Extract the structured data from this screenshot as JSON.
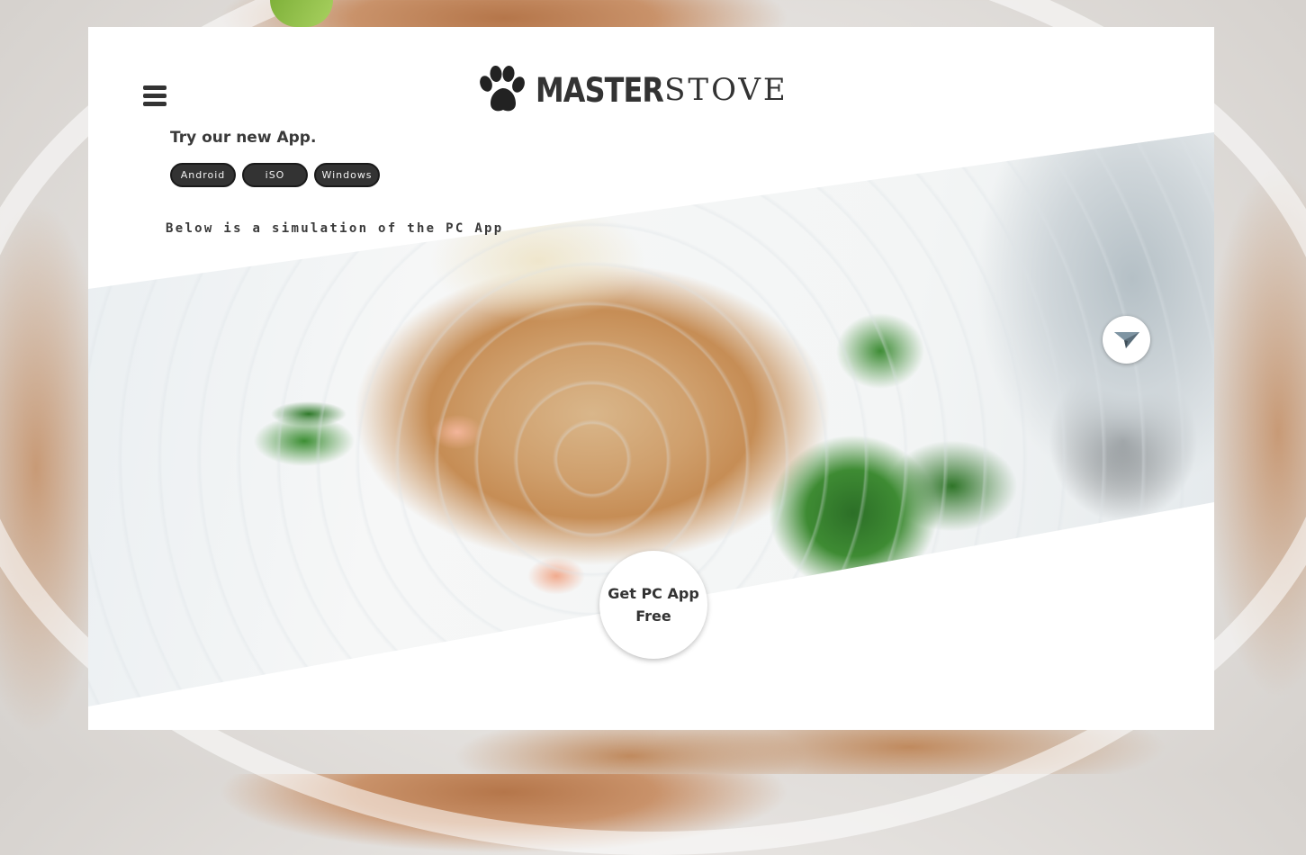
{
  "header": {
    "brand_bold": "MASTER",
    "brand_light": "STOVE",
    "logo_icon": "paw-icon",
    "menu_icon": "hamburger-menu-icon"
  },
  "promo": {
    "try_text": "Try our new App.",
    "buttons": {
      "android": "Android",
      "ios": "iSO",
      "windows": "Windows"
    },
    "simulation_text": "Below is a simulation of the PC App"
  },
  "hero": {
    "send_icon": "paper-plane-icon",
    "cta_line1": "Get PC App",
    "cta_line2": "Free"
  },
  "colors": {
    "text_dark": "#333333",
    "button_bg": "#333333",
    "card_bg": "#ffffff"
  }
}
